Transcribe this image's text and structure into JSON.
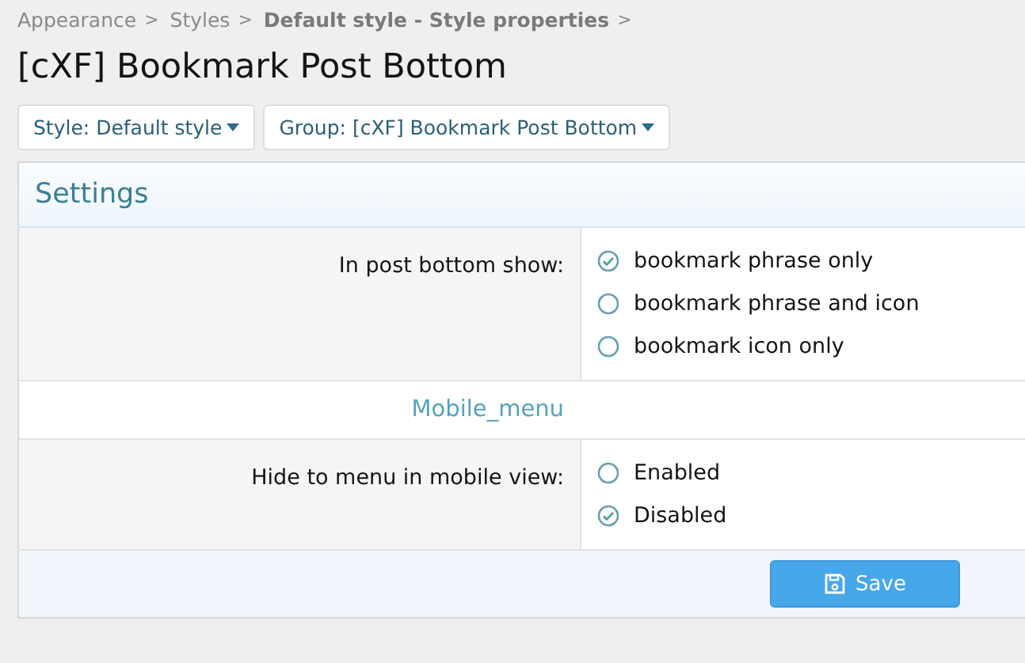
{
  "breadcrumb": [
    {
      "label": "Appearance",
      "bold": false
    },
    {
      "label": "Styles",
      "bold": false
    },
    {
      "label": "Default style - Style properties",
      "bold": true
    }
  ],
  "separator": ">",
  "title": "[cXF] Bookmark Post Bottom",
  "filters": [
    {
      "label": "Style: Default style"
    },
    {
      "label": "Group: [cXF] Bookmark Post Bottom"
    }
  ],
  "panel": {
    "title": "Settings",
    "sections": [
      {
        "kind": "option",
        "label": "In post bottom show:",
        "choices": [
          {
            "label": "bookmark phrase only",
            "selected": true
          },
          {
            "label": "bookmark phrase and icon",
            "selected": false
          },
          {
            "label": "bookmark icon only",
            "selected": false
          }
        ]
      },
      {
        "kind": "heading",
        "label": "Mobile_menu"
      },
      {
        "kind": "option",
        "label": "Hide to menu in mobile view:",
        "choices": [
          {
            "label": "Enabled",
            "selected": false
          },
          {
            "label": "Disabled",
            "selected": true
          }
        ]
      }
    ],
    "save_button": "Save"
  }
}
